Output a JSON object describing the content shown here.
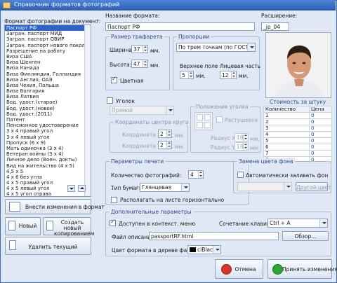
{
  "title": "Справочник форматов фотографий",
  "left": {
    "list_label": "Формат фотографии на документ:",
    "items": [
      "Паспорт РФ",
      "Загран. паспорт МИД",
      "Загран. паспорт ОВИР",
      "Загран. паспорт нового поколения",
      "Разрешение на работу",
      "Виза США",
      "Виза Шенген",
      "Виза Канада",
      "Виза Финляндия, Голландия",
      "Виза Англия, ОАЭ",
      "Виза Чехия, Польша",
      "Виза Болгария",
      "Виза Латвия",
      "Вод. удост.(старое)",
      "Вод. удост.(новое)",
      "Вод. удост.(2011)",
      "Патент",
      "Пенсионное удостоверение",
      "3 х 4 правый угол",
      "3 х 4 левый угол",
      "Пропуск (6 х 9)",
      "Мать одиночка (3 х 4)",
      "Ветеран войны (3 х 4)",
      "Личное дело (Воен. докты)",
      "Вид на жительство (4 х 5)",
      "4,5 х 5",
      "4 х 6 без угла",
      "4 х 5 правый угол",
      "4 х 5 левый угол",
      "4 х 5 угол справа"
    ],
    "apply_button": "Внести изменения в формат",
    "new_button": "Новый",
    "copy_button": "Создать новый копированием",
    "delete_button": "Удалить текущий"
  },
  "format": {
    "name_label": "Название формата:",
    "name_value": "Паспорт РФ",
    "ext_label": "Расширение:",
    "ext_value": "_jp_04"
  },
  "stencil": {
    "title": "Размер трафарета",
    "width_label": "Ширина:",
    "width_value": "37",
    "height_label": "Высота:",
    "height_value": "47",
    "unit": "мм.",
    "color_label": "Цветная"
  },
  "proportions": {
    "title": "Пропорции",
    "select_value": "По трем точкам (по ГОСТу)",
    "top_margin_label": "Верхнее поле",
    "top_margin_value": "5",
    "face_label": "Лицевая часть",
    "face_value": "12",
    "unit": "мм."
  },
  "corner": {
    "checkbox_label": "Уголок",
    "type_value": "Прямой",
    "center_title": "Координаты центра круга",
    "x_label": "Координата X",
    "x_value": "2",
    "y_label": "Координата Y",
    "y_value": "2",
    "unit": "мм.",
    "position_title": "Положение уголка",
    "stretch_label": "Растушевка",
    "rx_label": "Радиус X",
    "rx_value": "18",
    "ry_label": "Радиус Y",
    "ry_value": "18"
  },
  "cost": {
    "title": "Стоимость за штуку",
    "col_qty": "Количество",
    "col_price": "Цена",
    "rows": [
      [
        "1",
        "0"
      ],
      [
        "2",
        "0"
      ],
      [
        "3",
        "0"
      ],
      [
        "4",
        "0"
      ],
      [
        "5",
        "0"
      ],
      [
        "6",
        "0"
      ],
      [
        "7",
        "0"
      ],
      [
        "8",
        "0"
      ]
    ]
  },
  "print": {
    "title": "Параметры печати",
    "count_label": "Количество фотографий:",
    "count_value": "4",
    "paper_label": "Тип бумаги:",
    "paper_value": "Глянцевая",
    "horizontal_label": "Располагать на листе горизонтально"
  },
  "bg": {
    "title": "Замена цвета фона",
    "auto_label": "Автоматически заливать фон",
    "other_button": "Другой цвет"
  },
  "extra": {
    "title": "Дополнительные параметры",
    "context_label": "Доступен в контекст. меню",
    "hotkey_label": "Сочетание клавиш:",
    "hotkey_value": "Ctrl + A",
    "desc_label": "Файл описания:",
    "desc_value": "passportRF.html",
    "browse_button": "Обзор...",
    "tree_color_label": "Цвет формата в дереве файлов:",
    "tree_color_value": "clBlack"
  },
  "footer": {
    "cancel_button": "Отмена",
    "accept_button": "Принять изменения"
  },
  "colors": {
    "accent": "#2f63c7",
    "title_bar": "#2a5db8",
    "panel": "#dfe8f4"
  }
}
